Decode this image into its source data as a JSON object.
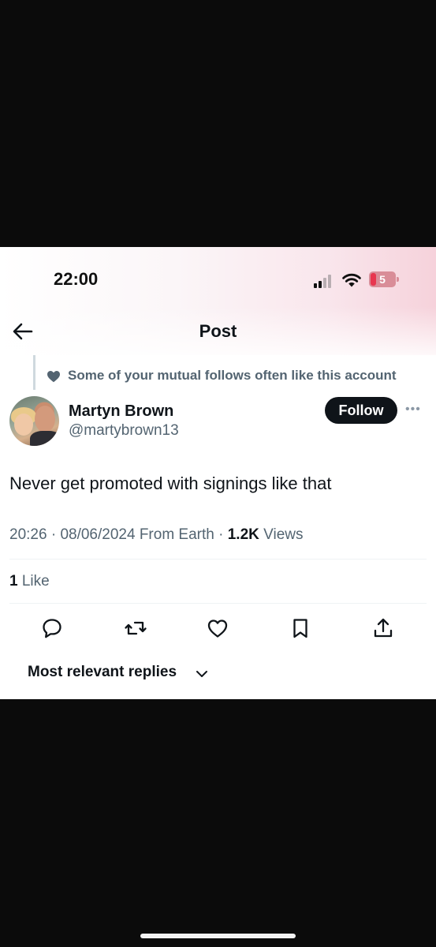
{
  "status_bar": {
    "time": "22:00",
    "battery": "5",
    "colors": {
      "battery_body": "#d98d98",
      "battery_low": "#e8364f"
    }
  },
  "nav": {
    "title": "Post",
    "back_icon": "arrow-left-icon"
  },
  "social_context": {
    "icon": "heart-filled-icon",
    "text": "Some of your mutual follows often like this account"
  },
  "author": {
    "name": "Martyn Brown",
    "handle": "@martybrown13",
    "follow_label": "Follow",
    "more_icon": "more-horizontal-icon"
  },
  "post": {
    "text": "Never get promoted with signings like that",
    "time": "20:26",
    "date": "08/06/2024",
    "source": "From Earth",
    "views_count": "1.2K",
    "views_label": " Views",
    "likes_count": "1",
    "likes_label": " Like"
  },
  "actions": [
    {
      "icon": "reply-icon"
    },
    {
      "icon": "repost-icon"
    },
    {
      "icon": "like-icon"
    },
    {
      "icon": "bookmark-icon"
    },
    {
      "icon": "share-icon"
    }
  ],
  "replies": {
    "sort_label": "Most relevant replies",
    "chevron_icon": "chevron-down-icon"
  },
  "colors": {
    "text_primary": "#0f1419",
    "text_secondary": "#536471",
    "follow_button": "#0f1419",
    "divider": "#eff3f4"
  }
}
